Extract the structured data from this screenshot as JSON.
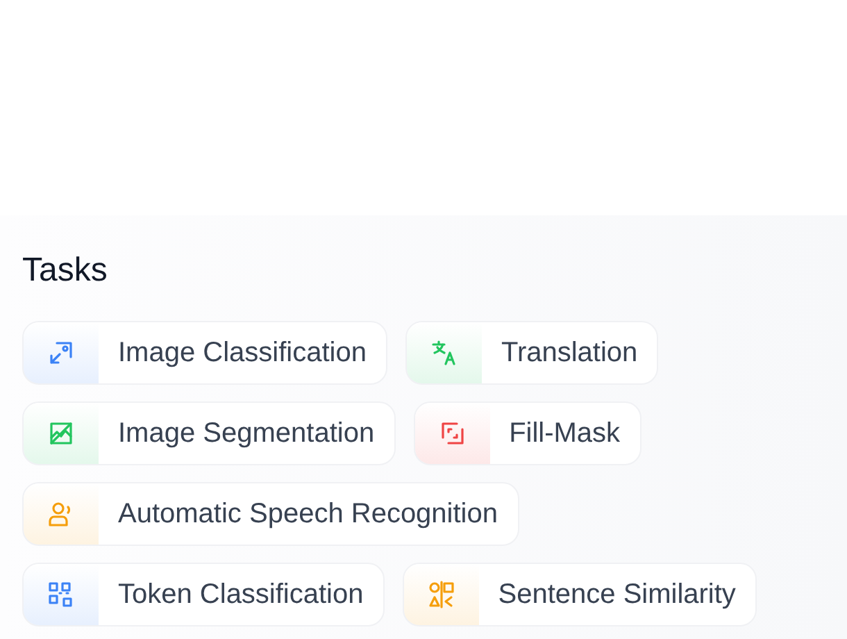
{
  "section": {
    "title": "Tasks"
  },
  "tasks": [
    {
      "label": "Image Classification",
      "kind": "image",
      "color": "#3b82f6"
    },
    {
      "label": "Translation",
      "kind": "translate",
      "color": "#22c55e"
    },
    {
      "label": "Image Segmentation",
      "kind": "segment",
      "color": "#22c55e"
    },
    {
      "label": "Fill-Mask",
      "kind": "mask",
      "color": "#ef4444"
    },
    {
      "label": "Automatic Speech Recognition",
      "kind": "speech",
      "color": "#f59e0b"
    },
    {
      "label": "Token Classification",
      "kind": "token",
      "color": "#3b82f6"
    },
    {
      "label": "Sentence Similarity",
      "kind": "similarity",
      "color": "#f59e0b"
    }
  ]
}
